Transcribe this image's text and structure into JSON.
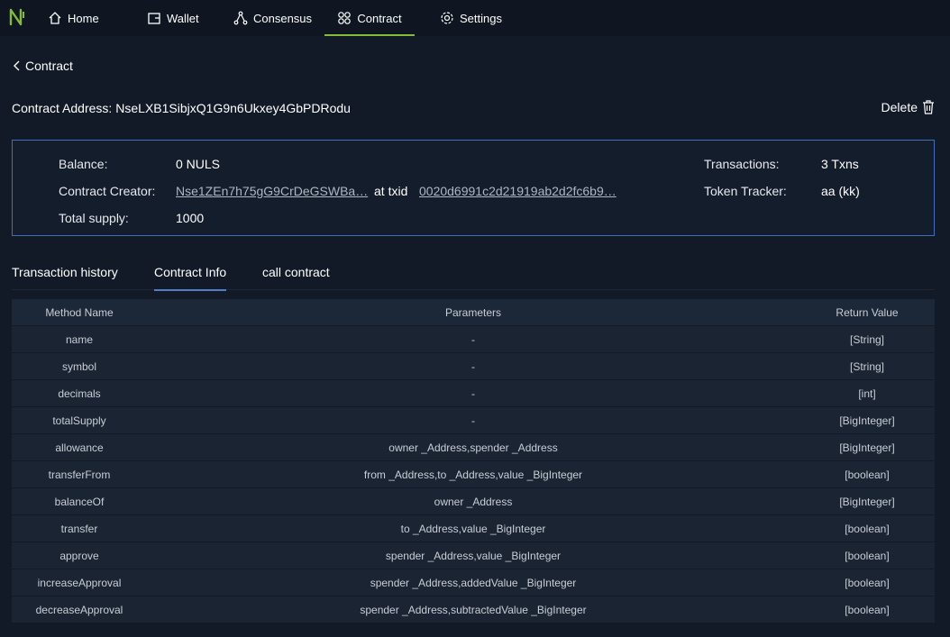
{
  "nav": {
    "home": "Home",
    "wallet": "Wallet",
    "consensus": "Consensus",
    "contract": "Contract",
    "settings": "Settings"
  },
  "back_label": "Contract",
  "address": {
    "label": "Contract Address:",
    "value": "NseLXB1SibjxQ1G9n6Ukxey4GbPDRodu"
  },
  "delete_label": "Delete",
  "info": {
    "balance_label": "Balance:",
    "balance_value": "0 NULS",
    "creator_label": "Contract Creator:",
    "creator_value": "Nse1ZEn7h75gG9CrDeGSWBa…",
    "at_txid": "at txid",
    "txid_value": "0020d6991c2d21919ab2d2fc6b9…",
    "supply_label": "Total supply:",
    "supply_value": "1000",
    "tx_label": "Transactions:",
    "tx_value": "3 Txns",
    "tracker_label": "Token Tracker:",
    "tracker_value": "aa (kk)"
  },
  "tabs": {
    "history": "Transaction history",
    "info": "Contract Info",
    "call": "call contract"
  },
  "table": {
    "headers": [
      "Method Name",
      "Parameters",
      "Return Value"
    ],
    "rows": [
      [
        "name",
        "-",
        "[String]"
      ],
      [
        "symbol",
        "-",
        "[String]"
      ],
      [
        "decimals",
        "-",
        "[int]"
      ],
      [
        "totalSupply",
        "-",
        "[BigInteger]"
      ],
      [
        "allowance",
        "owner _Address,spender _Address",
        "[BigInteger]"
      ],
      [
        "transferFrom",
        "from _Address,to _Address,value _BigInteger",
        "[boolean]"
      ],
      [
        "balanceOf",
        "owner _Address",
        "[BigInteger]"
      ],
      [
        "transfer",
        "to _Address,value _BigInteger",
        "[boolean]"
      ],
      [
        "approve",
        "spender _Address,value _BigInteger",
        "[boolean]"
      ],
      [
        "increaseApproval",
        "spender _Address,addedValue _BigInteger",
        "[boolean]"
      ],
      [
        "decreaseApproval",
        "spender _Address,subtractedValue _BigInteger",
        "[boolean]"
      ]
    ]
  },
  "colors": {
    "accent_green": "#82bd39",
    "box_border": "#3e6fb8",
    "tab_underline": "#4f7fc4"
  }
}
